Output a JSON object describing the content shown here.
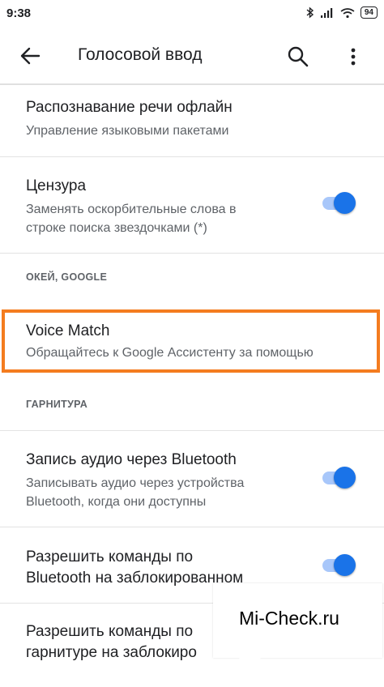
{
  "status_bar": {
    "time": "9:38",
    "battery": "94"
  },
  "app_bar": {
    "title": "Голосовой ввод"
  },
  "items": [
    {
      "title": "Распознавание речи офлайн",
      "subtitle": "Управление языковыми пакетами"
    },
    {
      "title": "Цензура",
      "subtitle_lines": [
        "Заменять оскорбительные слова в",
        "строке поиска звездочками (*)"
      ],
      "toggle_on": true
    },
    {
      "title": "Voice Match",
      "subtitle": "Обращайтесь к Google Ассистенту за помощью"
    },
    {
      "title": "Запись аудио через Bluetooth",
      "subtitle_lines": [
        "Записывать аудио через устройства",
        "Bluetooth, когда они доступны"
      ],
      "toggle_on": true
    },
    {
      "title_lines": [
        "Разрешить команды по",
        "Bluetooth на заблокированном"
      ],
      "toggle_on": true
    },
    {
      "title_lines": [
        "Разрешить команды по",
        "гарнитуре на заблокиро"
      ]
    }
  ],
  "sections": {
    "ok_google": "ОКЕЙ, GOOGLE",
    "headset": "ГАРНИТУРА"
  },
  "watermark": "Mi-Check.ru",
  "colors": {
    "accent": "#1a73e8",
    "highlight": "#f47c1f"
  }
}
